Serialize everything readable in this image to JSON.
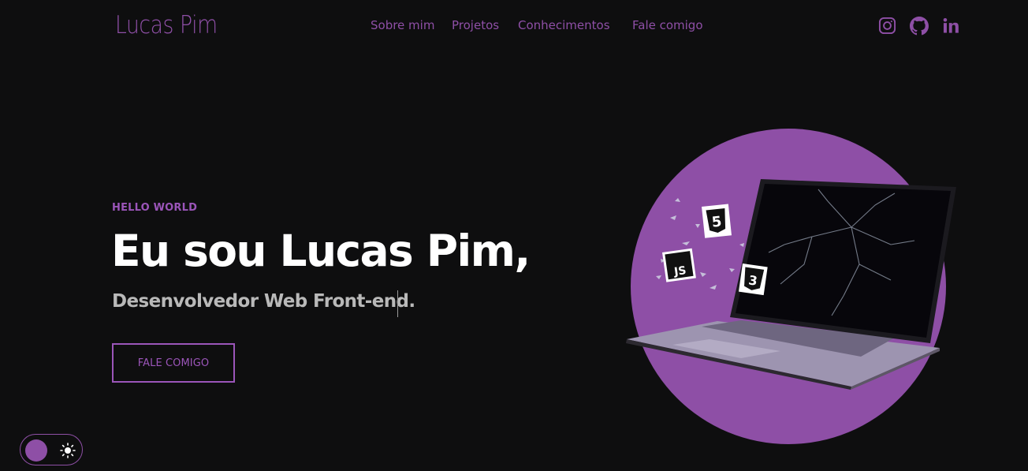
{
  "brand": {
    "name": "Lucas Pim"
  },
  "nav": {
    "items": [
      {
        "label": "Sobre mim"
      },
      {
        "label": "Projetos"
      },
      {
        "label": "Conhecimentos"
      },
      {
        "label": "Fale comigo"
      }
    ]
  },
  "social": {
    "items": [
      {
        "icon": "instagram-icon"
      },
      {
        "icon": "github-icon"
      },
      {
        "icon": "linkedin-icon"
      }
    ]
  },
  "hero": {
    "eyebrow": "HELLO WORLD",
    "headline": "Eu sou Lucas Pim,",
    "subline": "Desenvolvedor Web Front-end.",
    "cta_label": "FALE COMIGO",
    "badges": [
      "html5-icon",
      "javascript-icon",
      "css3-icon"
    ]
  },
  "theme_toggle": {
    "state": "dark",
    "icon": "sun-icon"
  },
  "colors": {
    "background": "#0e0e0f",
    "accent": "#8e4fa6",
    "accent_light": "#9b55b9",
    "text": "#ffffff",
    "muted_text": "#b9b9b9"
  }
}
